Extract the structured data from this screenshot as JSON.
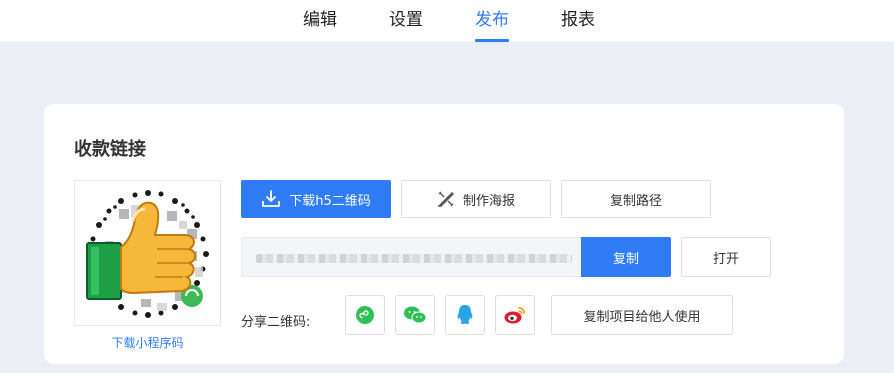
{
  "tabs": [
    {
      "label": "编辑",
      "active": false
    },
    {
      "label": "设置",
      "active": false
    },
    {
      "label": "发布",
      "active": true
    },
    {
      "label": "报表",
      "active": false
    }
  ],
  "colors": {
    "accent": "#2f7cf6",
    "page_bg": "#ebeef5"
  },
  "card": {
    "title": "收款链接",
    "qr_caption": "下载小程序码",
    "buttons": {
      "download_h5_qr": "下载h5二维码",
      "make_poster": "制作海报",
      "copy_path": "复制路径",
      "copy": "复制",
      "open": "打开",
      "copy_project": "复制项目给他人使用"
    },
    "share_label": "分享二维码:",
    "share_icons": [
      "mini-program-icon",
      "wechat-icon",
      "qq-icon",
      "weibo-icon"
    ]
  }
}
